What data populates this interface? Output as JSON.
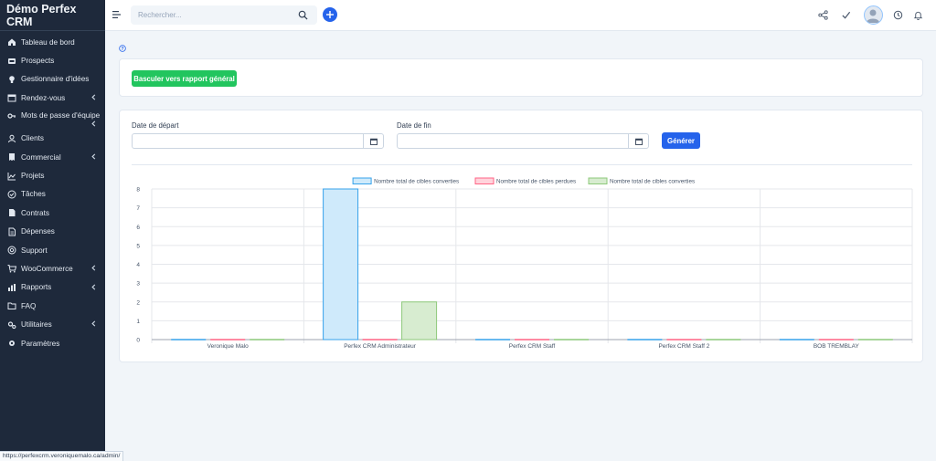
{
  "brand": "Démo Perfex CRM",
  "menu": [
    {
      "label": "Tableau de bord",
      "icon": "home-icon",
      "chevron": false
    },
    {
      "label": "Prospects",
      "icon": "tty-icon",
      "chevron": false
    },
    {
      "label": "Gestionnaire d'idées",
      "icon": "lightbulb-icon",
      "chevron": false
    },
    {
      "label": "Rendez-vous",
      "icon": "calendar-icon",
      "chevron": true
    },
    {
      "label": "Mots de passe d'équipe",
      "icon": "key-icon",
      "chevron": true
    },
    {
      "label": "Clients",
      "icon": "user-icon",
      "chevron": false
    },
    {
      "label": "Commercial",
      "icon": "receipt-icon",
      "chevron": true
    },
    {
      "label": "Projets",
      "icon": "chart-area-icon",
      "chevron": false
    },
    {
      "label": "Tâches",
      "icon": "check-circle-icon",
      "chevron": false
    },
    {
      "label": "Contrats",
      "icon": "file-contract-icon",
      "chevron": false
    },
    {
      "label": "Dépenses",
      "icon": "file-invoice-icon",
      "chevron": false
    },
    {
      "label": "Support",
      "icon": "life-ring-icon",
      "chevron": false
    },
    {
      "label": "WooCommerce",
      "icon": "cart-icon",
      "chevron": true
    },
    {
      "label": "Rapports",
      "icon": "reports-icon",
      "chevron": true
    },
    {
      "label": "FAQ",
      "icon": "folder-icon",
      "chevron": false
    },
    {
      "label": "Utilitaires",
      "icon": "cogs-icon",
      "chevron": true
    },
    {
      "label": "Paramètres",
      "icon": "cog-icon",
      "chevron": false
    }
  ],
  "header": {
    "search_placeholder": "Rechercher..."
  },
  "report": {
    "toggle_button": "Basculer vers rapport général",
    "start_date_label": "Date de départ",
    "end_date_label": "Date de fin",
    "start_date_value": "",
    "end_date_value": "",
    "generate_button": "Générer"
  },
  "chart_data": {
    "type": "bar",
    "categories": [
      "Veronique Malo",
      "Perfex CRM Administrateur",
      "Perfex CRM Staff",
      "Perfex CRM Staff 2",
      "BOB TREMBLAY"
    ],
    "series": [
      {
        "name": "Nombre total de cibles converties",
        "values": [
          0,
          8,
          0,
          0,
          0
        ],
        "color": "#36a2eb",
        "fill": "#cfeafb"
      },
      {
        "name": "Nombre total de cibles perdues",
        "values": [
          0,
          0,
          0,
          0,
          0
        ],
        "color": "#ff6384",
        "fill": "#ffd3dc"
      },
      {
        "name": "Nombre total de cibles converties",
        "values": [
          0,
          2,
          0,
          0,
          0
        ],
        "color": "#8cc97a",
        "fill": "#d7ecd0"
      }
    ],
    "ylim": [
      0,
      8
    ],
    "yticks": [
      0,
      1,
      2,
      3,
      4,
      5,
      6,
      7,
      8
    ],
    "grid": true,
    "legend": "top"
  },
  "status_url": "https://perfexcrm.veroniquemalo.ca/admin/",
  "colors": {
    "sidebar": "#1e293b",
    "primary": "#2563eb",
    "success": "#22c55e"
  }
}
